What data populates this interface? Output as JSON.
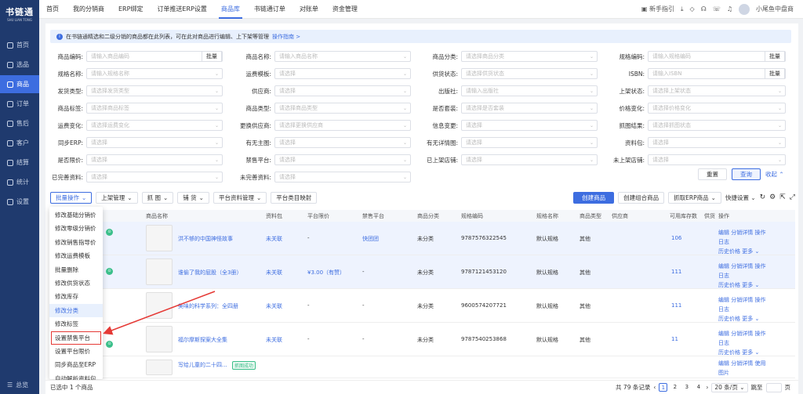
{
  "sidebar": {
    "logo": "书链通",
    "logo_sub": "SHU LIAN TONG",
    "items": [
      {
        "label": "首页"
      },
      {
        "label": "选品"
      },
      {
        "label": "商品"
      },
      {
        "label": "订单"
      },
      {
        "label": "售后"
      },
      {
        "label": "客户"
      },
      {
        "label": "结算"
      },
      {
        "label": "统计"
      },
      {
        "label": "设置"
      }
    ],
    "collapse": "总览"
  },
  "tabs": [
    {
      "label": "首页"
    },
    {
      "label": "我的分销商"
    },
    {
      "label": "ERP绑定"
    },
    {
      "label": "订单推送ERP设置"
    },
    {
      "label": "商品库"
    },
    {
      "label": "书链通订单"
    },
    {
      "label": "对账单"
    },
    {
      "label": "资金管理"
    }
  ],
  "topbar": {
    "guide": "新手指引",
    "user": "小尾鱼中盘商"
  },
  "notice": {
    "text": "在书链通精选和二级分销的商品都在此列表，可在此对商品进行编辑、上下架等管理",
    "link": "操作指南 >"
  },
  "filters": {
    "rows": [
      [
        {
          "label": "商品编码:",
          "ph": "请输入商品编码",
          "btn": "批量"
        },
        {
          "label": "商品名称:",
          "ph": "请输入商品名称"
        },
        {
          "label": "商品分类:",
          "ph": "请选择商品分类"
        },
        {
          "label": "规格编码:",
          "ph": "请输入规格编码",
          "btn": "批量"
        }
      ],
      [
        {
          "label": "规格名称:",
          "ph": "请输入规格名称"
        },
        {
          "label": "运费模板:",
          "ph": "请选择"
        },
        {
          "label": "供货状态:",
          "ph": "请选择供货状态"
        },
        {
          "label": "ISBN:",
          "ph": "请输入ISBN",
          "btn": "批量"
        }
      ],
      [
        {
          "label": "发货类型:",
          "ph": "请选择发货类型"
        },
        {
          "label": "供应商:",
          "ph": "请选择"
        },
        {
          "label": "出版社:",
          "ph": "请输入出版社"
        },
        {
          "label": "上架状态:",
          "ph": "请选择上架状态"
        }
      ],
      [
        {
          "label": "商品标签:",
          "ph": "请选择商品标签"
        },
        {
          "label": "商品类型:",
          "ph": "请选择商品类型"
        },
        {
          "label": "是否套装:",
          "ph": "请选择是否套装"
        },
        {
          "label": "价格变化:",
          "ph": "请选择价格变化"
        }
      ],
      [
        {
          "label": "运费变化:",
          "ph": "请选择运费变化"
        },
        {
          "label": "更换供应商:",
          "ph": "请选择更换供应商"
        },
        {
          "label": "信息变更:",
          "ph": "请选择"
        },
        {
          "label": "抓图结果:",
          "ph": "请选择抓图状态"
        }
      ],
      [
        {
          "label": "同步ERP:",
          "ph": "请选择"
        },
        {
          "label": "有无主图:",
          "ph": "请选择"
        },
        {
          "label": "有无详情图:",
          "ph": "请选择"
        },
        {
          "label": "资料包:",
          "ph": "请选择"
        }
      ],
      [
        {
          "label": "是否限价:",
          "ph": "请选择"
        },
        {
          "label": "禁售平台:",
          "ph": "请选择"
        },
        {
          "label": "已上架店铺:",
          "ph": "请选择"
        },
        {
          "label": "未上架店铺:",
          "ph": "请选择"
        }
      ],
      [
        {
          "label": "已完善资料:",
          "ph": "请选择"
        },
        {
          "label": "未完善资料:",
          "ph": "请选择"
        }
      ]
    ],
    "reset": "重置",
    "search": "查询",
    "collapse": "收起"
  },
  "toolbar": {
    "batch": "批量操作",
    "shelf": "上架管理",
    "grab": "抓 图",
    "sell": "铺 货",
    "platform": "平台资料管理",
    "catalog": "平台类目映射",
    "create": "创建商品",
    "create_combo": "创建组合商品",
    "grab_erp": "抓取ERP商品",
    "quick": "快捷设置"
  },
  "columns": [
    "商品名称",
    "资料包",
    "平台限价",
    "禁售平台",
    "商品分类",
    "规格编码",
    "规格名称",
    "商品类型",
    "供应商",
    "可用库存数",
    "供货",
    "操作"
  ],
  "rows": [
    {
      "name": "洪不够的中国神怪故事",
      "pack": "未关联",
      "limit": "-",
      "ban": "快团团",
      "cat": "未分类",
      "code": "9787576322545",
      "spec": "默认规格",
      "type": "其他",
      "sup": "",
      "stock": "106"
    },
    {
      "name": "谁偷了我的屁股（全3册）",
      "pack": "未关联",
      "limit": "¥3.00（有赞）",
      "ban": "-",
      "cat": "未分类",
      "code": "9787121453120",
      "spec": "默认规格",
      "type": "其他",
      "sup": "",
      "stock": "111"
    },
    {
      "name": "美味的科学系列：全四册",
      "pack": "未关联",
      "limit": "-",
      "ban": "-",
      "cat": "未分类",
      "code": "9600574207721",
      "spec": "默认规格",
      "type": "其他",
      "sup": "",
      "stock": "111"
    },
    {
      "name": "福尔摩斯探案大全集",
      "pack": "未关联",
      "limit": "-",
      "ban": "-",
      "cat": "未分类",
      "code": "9787540253868",
      "spec": "默认规格",
      "type": "其他",
      "sup": "",
      "stock": "11"
    },
    {
      "name": "写给儿童的二十四...",
      "tag": "抓图成功"
    }
  ],
  "ops": {
    "edit": "编辑",
    "dist": "分销详情",
    "log": "操作日志",
    "history": "历史价格",
    "more": "更多",
    "pic": "使用图片"
  },
  "dropdown": [
    "修改基础分销价",
    "修改零级分销价",
    "修改销售指导价",
    "修改运费模板",
    "批量删除",
    "修改供货状态",
    "修改库存",
    "修改分类",
    "修改标签",
    "设置禁售平台",
    "设置平台限价",
    "同步商品至ERP",
    "自动解析资料包"
  ],
  "footer": {
    "selected": "已选中 1 个商品",
    "total": "共 79 条记录",
    "pages": [
      "1",
      "2",
      "3",
      "4"
    ],
    "page_size": "20 条/页",
    "jump": "跳至",
    "page_unit": "页"
  }
}
